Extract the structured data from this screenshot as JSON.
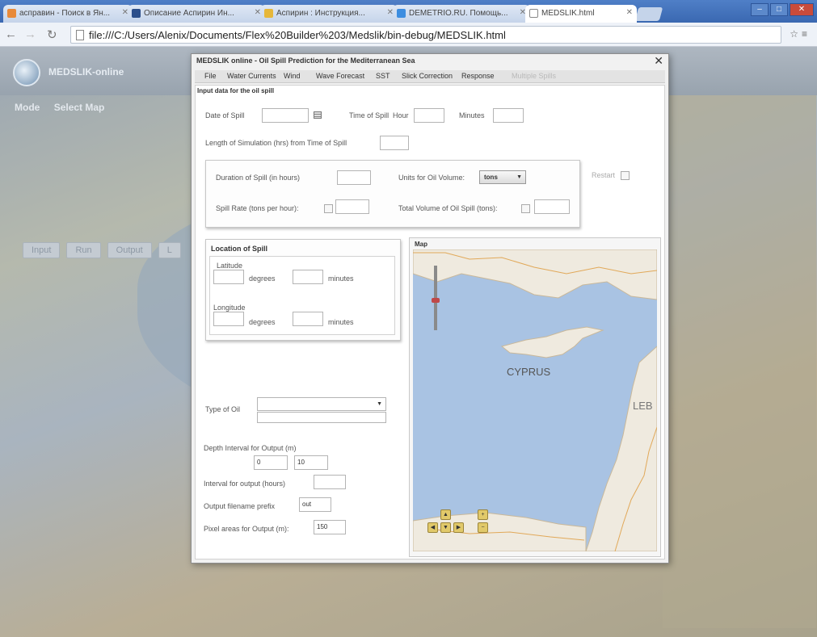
{
  "browser": {
    "tabs": [
      {
        "label": "асправин - Поиск в Ян..."
      },
      {
        "label": "Описание Аспирин Ин..."
      },
      {
        "label": "Аспирин : Инструкция..."
      },
      {
        "label": "DEMETRIO.RU. Помощь..."
      },
      {
        "label": "MEDSLIK.html"
      }
    ],
    "url": "file:///C:/Users/Alenix/Documents/Flex%20Builder%203/Medslik/bin-debug/MEDSLIK.html"
  },
  "app": {
    "logo_text": "MEDSLIK-online",
    "menu": [
      "Mode",
      "Select Map"
    ],
    "side_buttons": [
      "Input",
      "Run",
      "Output",
      "L"
    ]
  },
  "dialog": {
    "title": "MEDSLIK online - Oil Spill Prediction for the Mediterranean Sea",
    "close": "✕",
    "menu": [
      {
        "label": "File",
        "disabled": false
      },
      {
        "label": "Water Currents",
        "disabled": false
      },
      {
        "label": "Wind",
        "disabled": false
      },
      {
        "label": "Wave Forecast",
        "disabled": false
      },
      {
        "label": "SST",
        "disabled": false
      },
      {
        "label": "Slick Correction",
        "disabled": false
      },
      {
        "label": "Response",
        "disabled": false
      },
      {
        "label": "Multiple Spills",
        "disabled": true
      }
    ],
    "section_title": "Input data for the oil spill",
    "date_of_spill": "Date of Spill",
    "time_of_spill": "Time of Spill",
    "hour": "Hour",
    "minutes": "Minutes",
    "sim_length": "Length of Simulation (hrs) from Time of Spill",
    "duration": "Duration of Spill (in hours)",
    "units_volume": "Units for Oil Volume:",
    "units_value": "tons",
    "restart": "Restart",
    "spill_rate": "Spill Rate (tons per hour):",
    "total_volume": "Total Volume of Oil Spill (tons):",
    "location_title": "Location of Spill",
    "latitude": "Latitude",
    "longitude": "Longitude",
    "degrees": "degrees",
    "minutes_lower": "minutes",
    "type_of_oil": "Type of Oil",
    "depth_interval": "Depth Interval for Output (m)",
    "depth_from": "0",
    "depth_to": "10",
    "interval_output": "Interval for output (hours)",
    "output_prefix": "Output filename prefix",
    "output_prefix_value": "out",
    "pixel_areas": "Pixel areas for Output (m):",
    "pixel_areas_value": "150"
  },
  "map": {
    "label": "Map",
    "cyprus": "CYPRUS",
    "leb": "LEB"
  }
}
